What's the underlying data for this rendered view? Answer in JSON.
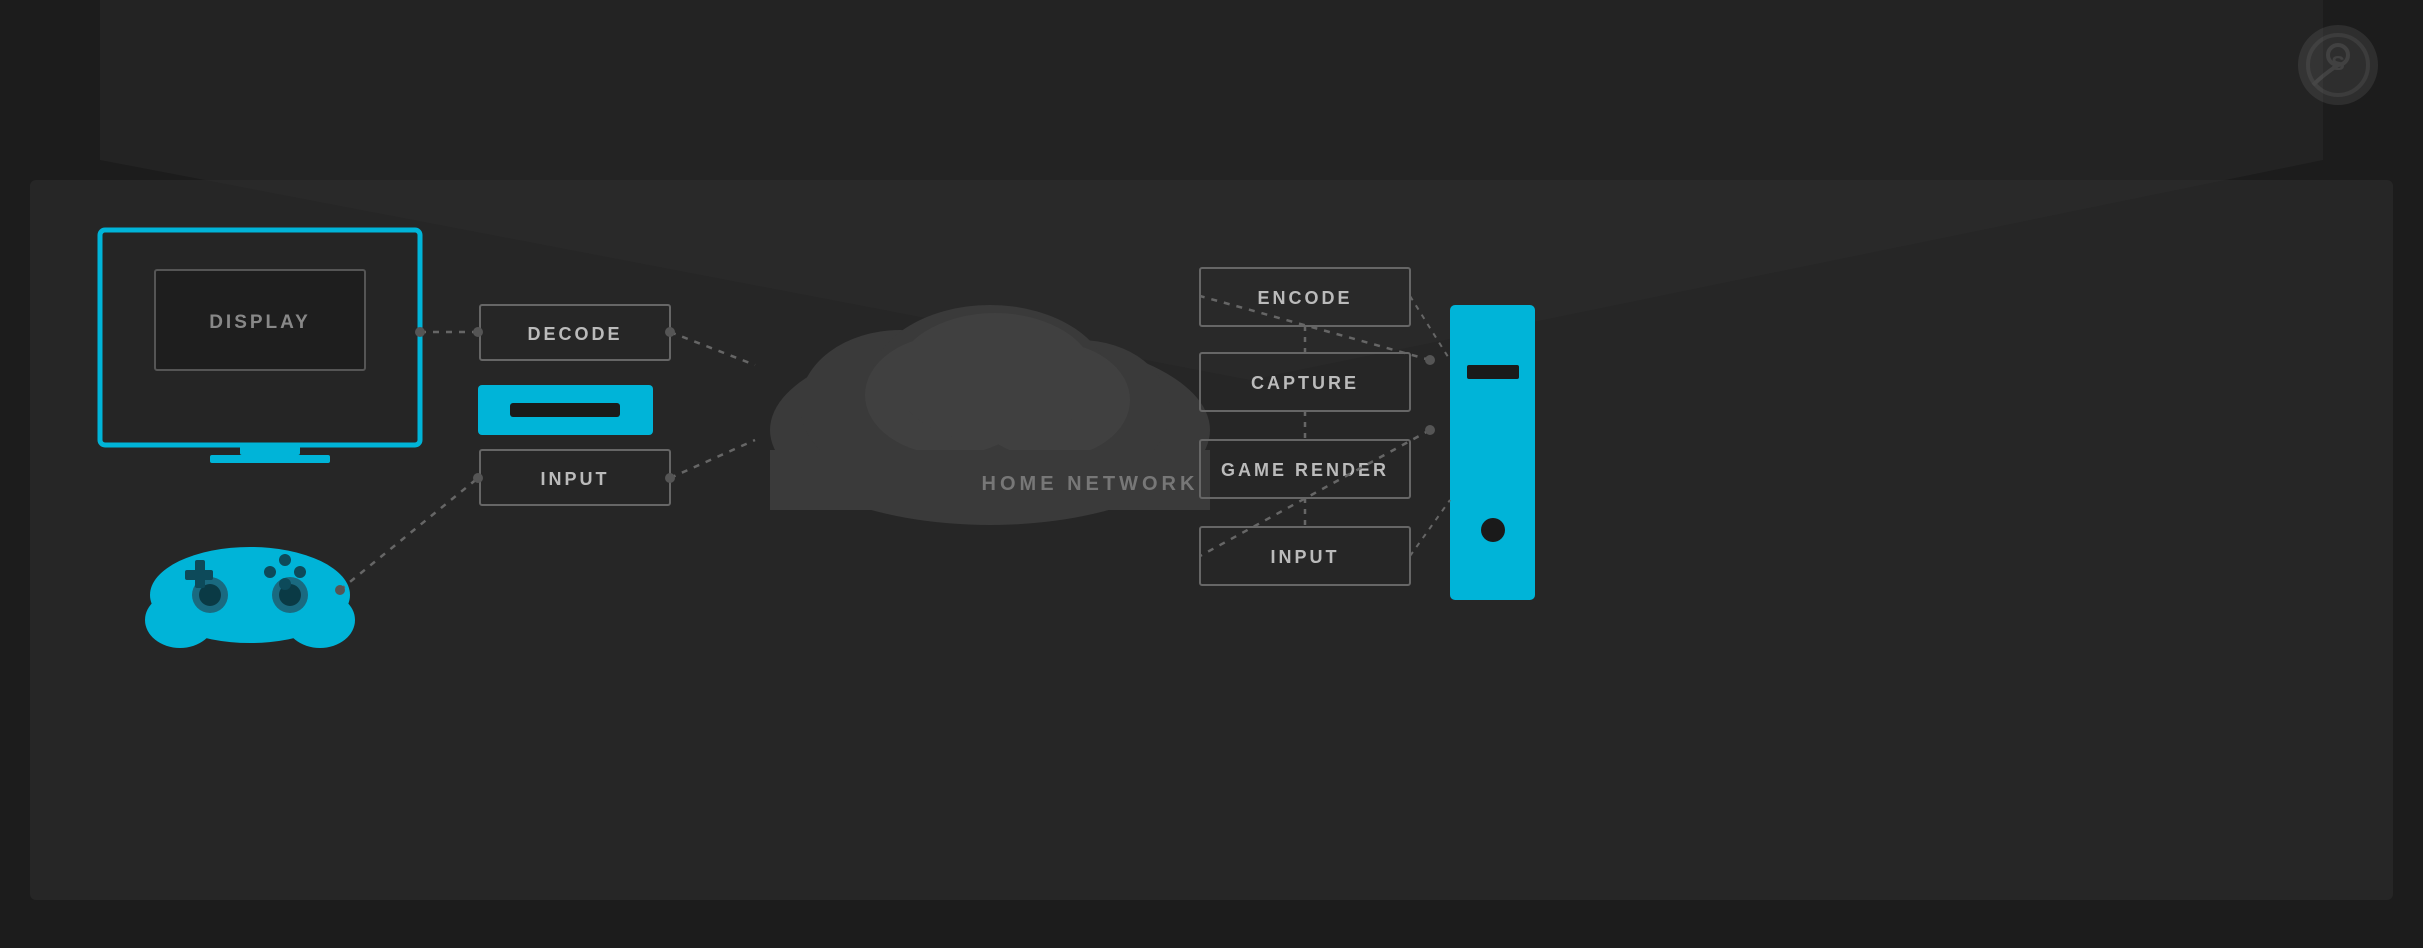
{
  "background": {
    "color": "#1c1c1c",
    "house_fill": "#2e2e2e",
    "house_stroke": "#3a3a3a"
  },
  "accent_color": "#00b4d8",
  "connector_color": "#666666",
  "text_color": "#cccccc",
  "muted_color": "#888888",
  "labels": {
    "display": "DISPLAY",
    "decode": "DECODE",
    "input_left": "INPUT",
    "home_network": "HOME NETWORK",
    "encode": "ENCODE",
    "capture": "CAPTURE",
    "game_render": "GAME RENDER",
    "input_right": "INPUT"
  },
  "steam_logo": {
    "opacity": "0.35"
  }
}
